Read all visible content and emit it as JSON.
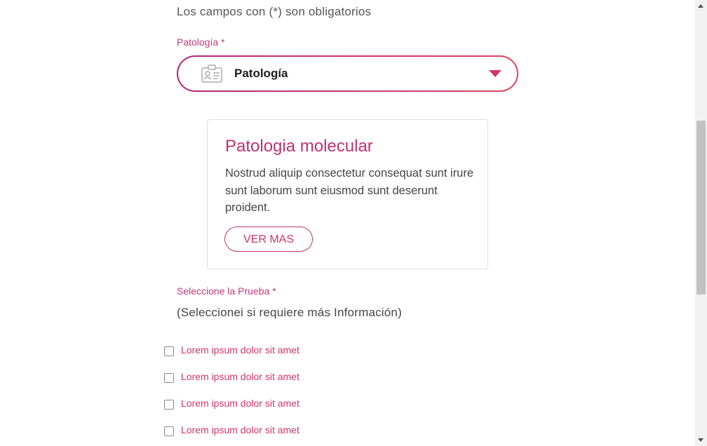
{
  "form": {
    "required_note": "Los campos con (*) son obligatorios",
    "patologia_label": "Patología *",
    "patologia_select": {
      "value": "Patología",
      "icon": "id-card-icon",
      "caret_icon": "caret-down-icon"
    },
    "prueba_label": "Seleccione la Prueba *",
    "info_text": "(Seleccionei si requiere más Información)",
    "checkboxes": [
      {
        "label": "Lorem ipsum dolor sit amet",
        "checked": false
      },
      {
        "label": "Lorem ipsum dolor sit amet",
        "checked": false
      },
      {
        "label": "Lorem ipsum dolor sit amet",
        "checked": false
      },
      {
        "label": "Lorem ipsum dolor sit amet",
        "checked": false
      }
    ]
  },
  "card": {
    "title": "Patologia molecular",
    "body": "Nostrud aliquip consectetur consequat sunt irure sunt laborum sunt eiusmod sunt deserunt proident.",
    "button_label": "VER MAS"
  },
  "colors": {
    "accent": "#c2306e",
    "accent_light": "#d33468",
    "gradient_start": "#b7247a",
    "gradient_end": "#e0435f",
    "text": "#444444"
  }
}
